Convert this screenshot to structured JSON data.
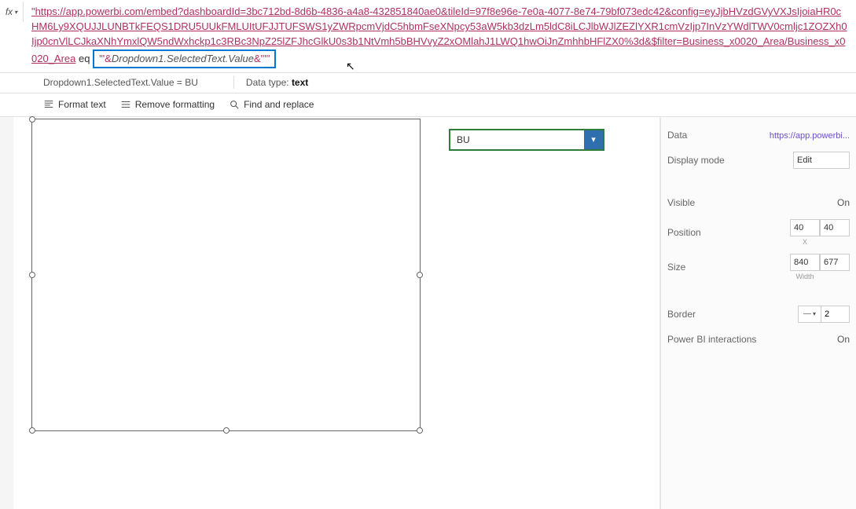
{
  "formula": {
    "fx_label": "fx",
    "url_part1": "\"https://app.powerbi.com/embed?dashboardId=3bc712bd-8d6b-4836-a4a8-432851840ae0&tileId=97f8e96e-7e0a-4077-8e74-79bf073edc42&config=eyJjbHVzdGVyVXJsIjoiaHR0cHM6Ly9XQUJJLUNBTkFEQS1DRU5UUkFMLUItUFJJTUFSWS1yZWRpcmVjdC5hbmFseXNpcy53aW5kb3dzLm5ldC8iLCJlbWJlZEZlYXR1cmVzIjp7InVzYWdlTWV0cmljc1ZOZXh0Ijp0cnVlLCJkaXNhYmxlQW5ndWxhckp1c3RBc3NpZ25lZFJhcGlkU0s3b1NtVmh5bBHVvyZ2xOMlahJ1LWQ1hwOiJnZmhhbHFlZX0%3d&$filter=Business_x0020_Area/Business_x0020_Area",
    "eq_text": " eq ",
    "highlighted_prefix": "'\"&",
    "highlighted_expr": "Dropdown1.SelectedText.Value",
    "highlighted_suffix": "&\"'\"",
    "result_line": "Dropdown1.SelectedText.Value  =  BU",
    "data_type_label": "Data type: ",
    "data_type_value": "text"
  },
  "toolbar": {
    "format_text": "Format text",
    "remove_formatting": "Remove formatting",
    "find_replace": "Find and replace"
  },
  "dropdown": {
    "value": "BU"
  },
  "properties": {
    "data_label": "Data",
    "data_value": "https://app.powerbi...",
    "display_mode_label": "Display mode",
    "display_mode_value": "Edit",
    "visible_label": "Visible",
    "visible_value": "On",
    "position_label": "Position",
    "position_x": "40",
    "position_y": "40",
    "position_x_sub": "X",
    "size_label": "Size",
    "size_w": "840",
    "size_h": "677",
    "size_w_sub": "Width",
    "border_label": "Border",
    "border_style": "—",
    "border_width": "2",
    "pbi_label": "Power BI interactions",
    "pbi_value": "On"
  }
}
